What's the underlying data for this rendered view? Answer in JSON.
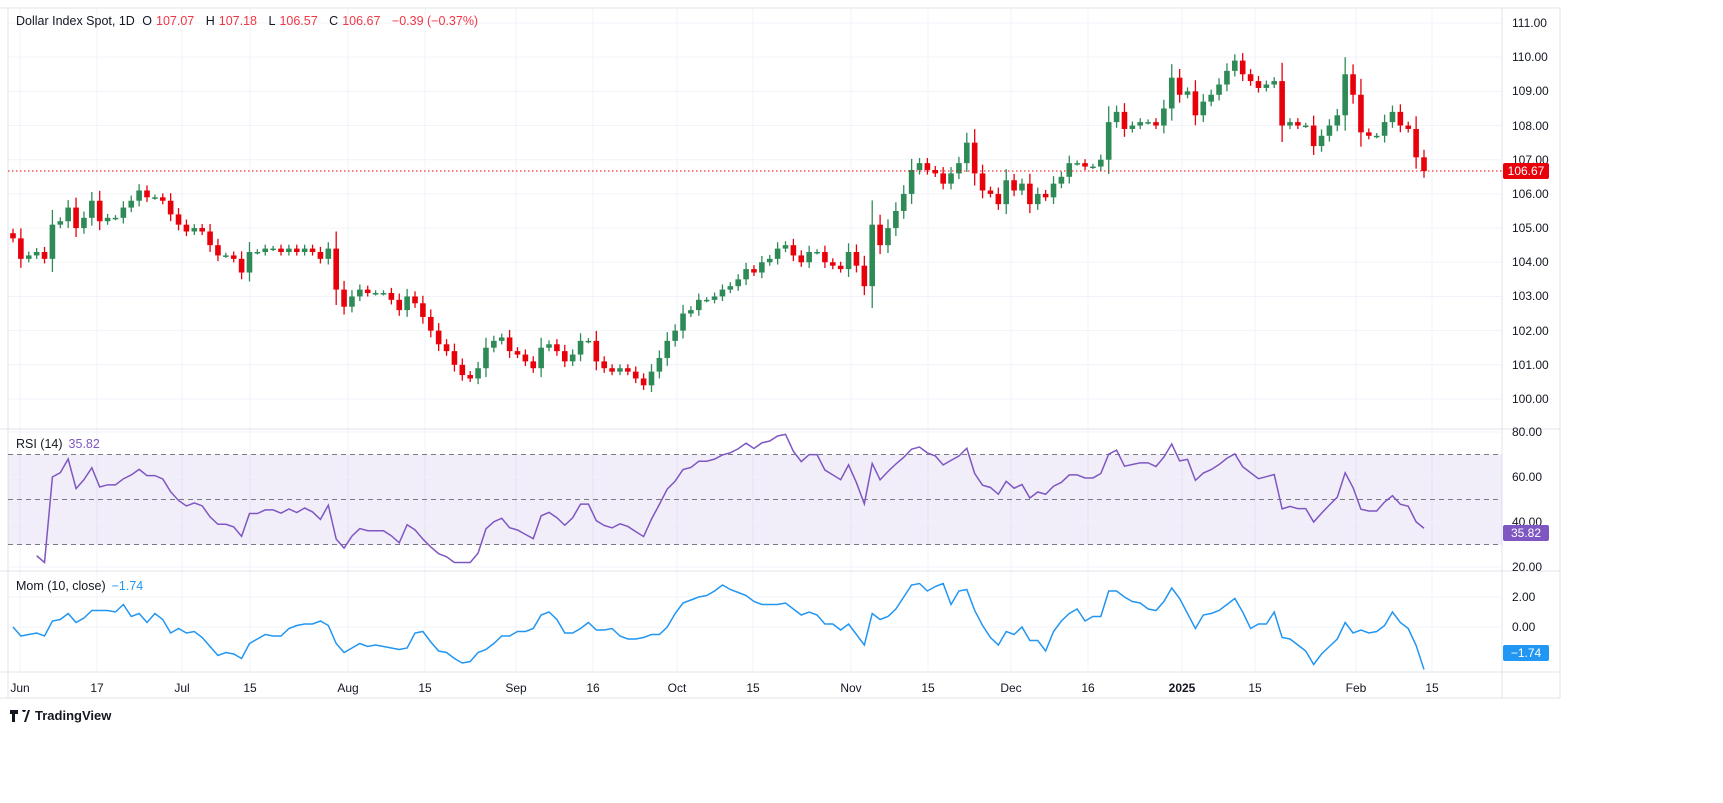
{
  "header": {
    "symbol": "Dollar Index Spot, 1D",
    "open_label": "O",
    "open": "107.07",
    "high_label": "H",
    "high": "107.18",
    "low_label": "L",
    "low": "106.57",
    "close_label": "C",
    "close": "106.67",
    "change": "−0.39 (−0.37%)"
  },
  "colors": {
    "up": "#2e8b57",
    "down": "#e8000b",
    "rsi": "#7e57c2",
    "mom": "#2196f3",
    "grid": "#f0f3fa"
  },
  "price_axis": {
    "ticks": [
      "111.00",
      "110.00",
      "109.00",
      "108.00",
      "107.00",
      "106.00",
      "105.00",
      "104.00",
      "103.00",
      "102.00",
      "101.00",
      "100.00"
    ],
    "last": "106.67"
  },
  "rsi": {
    "label": "RSI (14)",
    "value": "35.82",
    "ticks": [
      "80.00",
      "60.00",
      "40.00",
      "20.00"
    ],
    "bands": [
      70,
      50,
      30
    ]
  },
  "mom": {
    "label": "Mom (10, close)",
    "value": "−1.74",
    "ticks": [
      "2.00",
      "0.00"
    ]
  },
  "x_axis": {
    "labels": [
      "Jun",
      "17",
      "Jul",
      "15",
      "Aug",
      "15",
      "Sep",
      "16",
      "Oct",
      "15",
      "Nov",
      "15",
      "Dec",
      "16",
      "2025",
      "15",
      "Feb",
      "15"
    ]
  },
  "branding": {
    "logo": "TradingView"
  },
  "chart_data": {
    "type": "candlestick",
    "title": "Dollar Index Spot, 1D",
    "ylim": [
      99.15,
      111.38
    ],
    "close": [
      104.7,
      104.1,
      104.2,
      104.3,
      104.1,
      105.1,
      105.2,
      105.6,
      105.0,
      105.3,
      105.8,
      105.2,
      105.3,
      105.3,
      105.6,
      105.8,
      106.1,
      105.9,
      105.9,
      105.8,
      105.4,
      105.1,
      104.9,
      105.0,
      104.9,
      104.5,
      104.2,
      104.2,
      104.1,
      103.7,
      104.3,
      104.3,
      104.4,
      104.4,
      104.3,
      104.4,
      104.3,
      104.4,
      104.3,
      104.1,
      104.4,
      103.2,
      102.7,
      103.0,
      103.2,
      103.1,
      103.1,
      103.1,
      102.9,
      102.6,
      103.0,
      102.8,
      102.4,
      102.0,
      101.6,
      101.4,
      101.0,
      100.7,
      100.6,
      100.9,
      101.5,
      101.7,
      101.8,
      101.4,
      101.3,
      101.1,
      100.9,
      101.5,
      101.6,
      101.4,
      101.1,
      101.3,
      101.7,
      101.7,
      101.1,
      100.9,
      100.8,
      100.9,
      100.8,
      100.6,
      100.4,
      100.8,
      101.2,
      101.7,
      102.0,
      102.5,
      102.6,
      102.9,
      102.9,
      103.0,
      103.2,
      103.3,
      103.5,
      103.8,
      103.7,
      104.0,
      104.1,
      104.4,
      104.5,
      104.2,
      104.0,
      104.3,
      104.3,
      104.0,
      103.9,
      103.8,
      104.3,
      103.9,
      103.3,
      105.1,
      104.5,
      105.0,
      105.5,
      106.0,
      106.7,
      106.9,
      106.7,
      106.6,
      106.3,
      106.6,
      106.9,
      107.5,
      106.6,
      106.1,
      106.0,
      105.7,
      106.4,
      106.1,
      106.3,
      105.7,
      106.0,
      105.9,
      106.3,
      106.5,
      106.9,
      106.9,
      106.8,
      106.8,
      107.0,
      108.1,
      108.4,
      107.9,
      108.0,
      108.1,
      108.1,
      108.0,
      108.5,
      109.4,
      108.9,
      109.0,
      108.3,
      108.7,
      108.9,
      109.2,
      109.6,
      109.9,
      109.5,
      109.3,
      109.1,
      109.2,
      109.3,
      108.0,
      108.1,
      108.0,
      108.0,
      107.4,
      107.7,
      108.0,
      108.3,
      109.5,
      108.9,
      107.8,
      107.7,
      107.7,
      108.1,
      108.4,
      108.0,
      107.9,
      107.07,
      106.67
    ]
  }
}
